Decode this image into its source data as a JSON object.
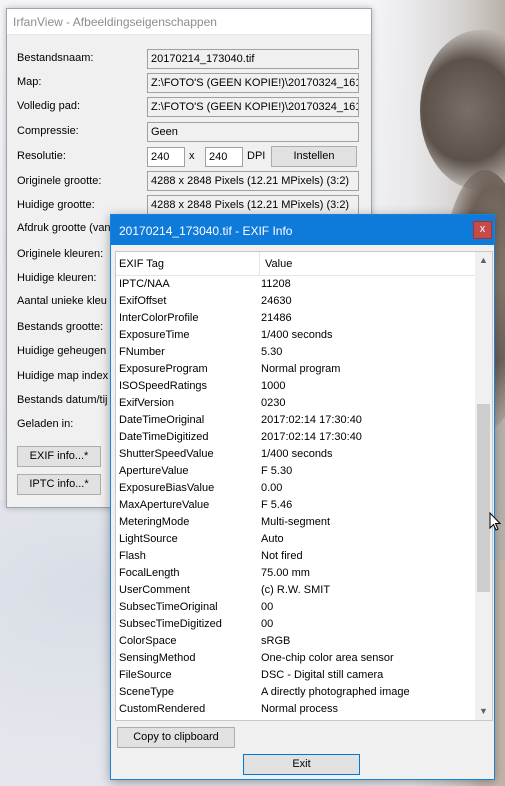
{
  "props": {
    "title": "IrfanView - Afbeeldingseigenschappen",
    "rows": [
      {
        "label": "Bestandsnaam:",
        "value": "20170214_173040.tif"
      },
      {
        "label": "Map:",
        "value": "Z:\\FOTO'S (GEEN KOPIE!)\\20170324_161"
      },
      {
        "label": "Volledig pad:",
        "value": "Z:\\FOTO'S (GEEN KOPIE!)\\20170324_161"
      },
      {
        "label": "Compressie:",
        "value": "Geen"
      }
    ],
    "resolution": {
      "label": "Resolutie:",
      "x": "240",
      "sep": "x",
      "y": "240",
      "unit": "DPI",
      "button": "Instellen"
    },
    "rows2": [
      {
        "label": "Originele grootte:",
        "value": "4288 x 2848  Pixels (12.21 MPixels) (3:2)"
      },
      {
        "label": "Huidige grootte:",
        "value": "4288 x 2848  Pixels (12.21 MPixels) (3:2)"
      }
    ],
    "labels_hidden": [
      "Afdruk grootte (van",
      "Originele kleuren:",
      "Huidige kleuren:",
      "Aantal unieke kleu",
      "Bestands grootte:",
      "Huidige geheugen",
      "Huidige map index",
      "Bestands datum/tij",
      "Geladen in:"
    ],
    "exif_button": "EXIF info...*",
    "iptc_button": "IPTC info...*"
  },
  "exif": {
    "title": "20170214_173040.tif - EXIF Info",
    "close_glyph": "x",
    "col_tag": "EXIF Tag",
    "col_value": "Value",
    "rows": [
      {
        "tag": "IPTC/NAA",
        "value": "11208"
      },
      {
        "tag": "ExifOffset",
        "value": "24630"
      },
      {
        "tag": "InterColorProfile",
        "value": "21486"
      },
      {
        "tag": "ExposureTime",
        "value": "1/400 seconds"
      },
      {
        "tag": "FNumber",
        "value": "5.30"
      },
      {
        "tag": "ExposureProgram",
        "value": "Normal program"
      },
      {
        "tag": "ISOSpeedRatings",
        "value": "1000"
      },
      {
        "tag": "ExifVersion",
        "value": "0230"
      },
      {
        "tag": "DateTimeOriginal",
        "value": "2017:02:14 17:30:40"
      },
      {
        "tag": "DateTimeDigitized",
        "value": "2017:02:14 17:30:40"
      },
      {
        "tag": "ShutterSpeedValue",
        "value": "1/400 seconds"
      },
      {
        "tag": "ApertureValue",
        "value": "F 5.30"
      },
      {
        "tag": "ExposureBiasValue",
        "value": "0.00"
      },
      {
        "tag": "MaxApertureValue",
        "value": "F 5.46"
      },
      {
        "tag": "MeteringMode",
        "value": "Multi-segment"
      },
      {
        "tag": "LightSource",
        "value": "Auto"
      },
      {
        "tag": "Flash",
        "value": "Not fired"
      },
      {
        "tag": "FocalLength",
        "value": "75.00 mm"
      },
      {
        "tag": "UserComment",
        "value": "(c) R.W. SMIT"
      },
      {
        "tag": "SubsecTimeOriginal",
        "value": "00"
      },
      {
        "tag": "SubsecTimeDigitized",
        "value": "00"
      },
      {
        "tag": "ColorSpace",
        "value": "sRGB"
      },
      {
        "tag": "SensingMethod",
        "value": "One-chip color area sensor"
      },
      {
        "tag": "FileSource",
        "value": "DSC - Digital still camera"
      },
      {
        "tag": "SceneType",
        "value": "A directly photographed image"
      },
      {
        "tag": "CustomRendered",
        "value": "Normal process"
      }
    ],
    "copy_button": "Copy to clipboard",
    "exit_button": "Exit"
  }
}
